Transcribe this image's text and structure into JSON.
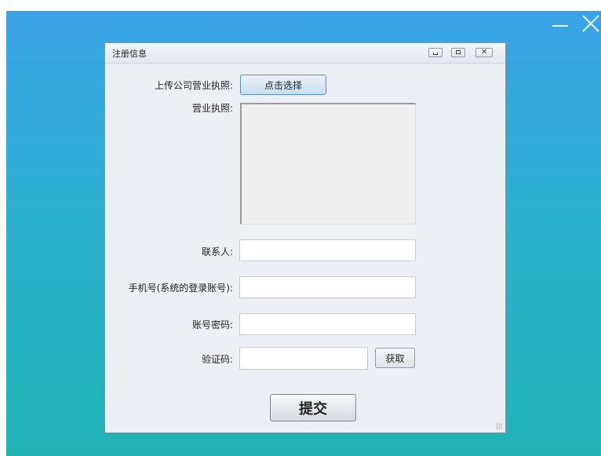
{
  "dialog": {
    "title": "注册信息",
    "window_buttons": {
      "minimize": "minimize-icon",
      "maximize": "maximize-icon",
      "close": "close-icon"
    }
  },
  "form": {
    "upload_label": "上传公司营业执照:",
    "select_button": "点击选择",
    "license_label": "营业执照:",
    "contact_label": "联系人:",
    "contact_value": "",
    "phone_label": "手机号(系统的登录账号):",
    "phone_value": "",
    "password_label": "账号密码:",
    "password_value": "",
    "code_label": "验证码:",
    "code_value": "",
    "get_code_button": "获取",
    "submit_button": "提交"
  },
  "colors": {
    "background_top": "#3aa3e6",
    "background_bottom": "#1fb2b3",
    "dialog_bg": "#eceff3"
  }
}
